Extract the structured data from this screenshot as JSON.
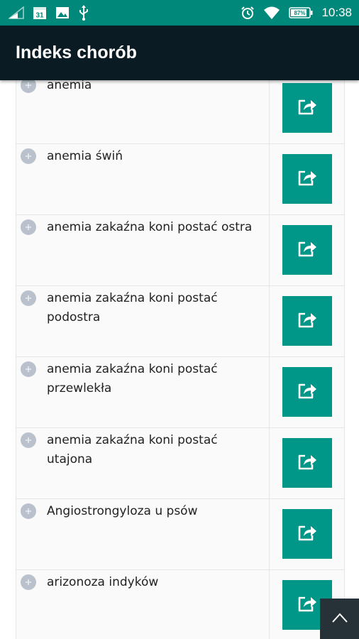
{
  "status_bar": {
    "time": "10:38",
    "battery_percent": "87%",
    "date_icon_day": "31",
    "icons": [
      "signal-icon",
      "calendar-icon",
      "image-icon",
      "usb-icon",
      "alarm-icon",
      "wifi-icon",
      "battery-icon"
    ]
  },
  "app_bar": {
    "title": "Indeks chorób"
  },
  "colors": {
    "status_bar": "#00897b",
    "app_bar": "#0b1b24",
    "accent": "#009688",
    "plus_icon": "#b9c2cc",
    "scroll_button": "#263238"
  },
  "items": [
    {
      "label": "anemia"
    },
    {
      "label": "anemia świń"
    },
    {
      "label": "anemia zakaźna koni postać ostra"
    },
    {
      "label": "anemia zakaźna koni postać\npodostra"
    },
    {
      "label": "anemia zakaźna koni postać\nprzewlekła"
    },
    {
      "label": "anemia zakaźna koni postać\nutajona"
    },
    {
      "label": "Angiostrongyloza u psów"
    },
    {
      "label": "arizonoza indyków"
    }
  ]
}
